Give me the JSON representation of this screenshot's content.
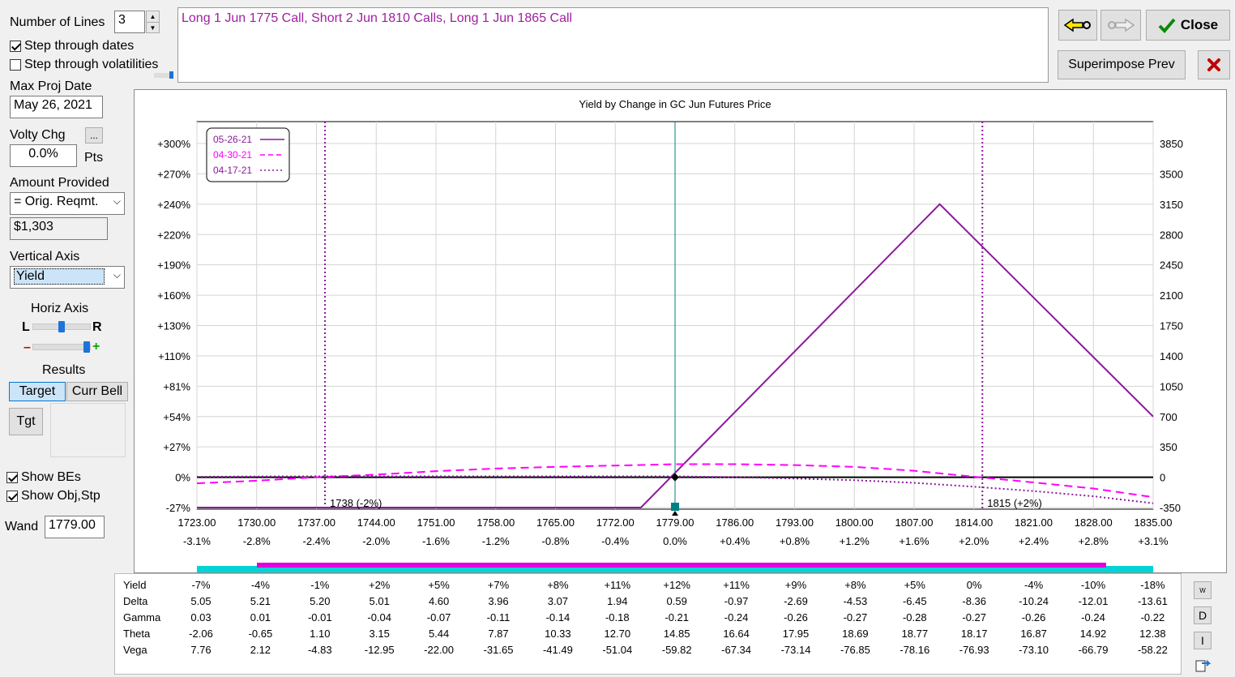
{
  "controls": {
    "number_of_lines_label": "Number of Lines",
    "number_of_lines_value": "3",
    "step_dates_label": "Step through dates",
    "step_dates_checked": true,
    "step_vols_label": "Step through volatilities",
    "step_vols_checked": false,
    "max_proj_date_label": "Max Proj Date",
    "max_proj_date_value": "May 26, 2021",
    "volty_chg_label": "Volty Chg",
    "volty_chg_button": "...",
    "volty_chg_value": "0.0%",
    "volty_chg_unit": "Pts",
    "amount_provided_label": "Amount Provided",
    "amount_provided_select": "= Orig. Reqmt.",
    "amount_value": "$1,303",
    "vertical_axis_label": "Vertical Axis",
    "vertical_axis_select": "Yield",
    "horiz_axis_label": "Horiz Axis",
    "horiz_l": "L",
    "horiz_r": "R",
    "zoom_minus": "–",
    "zoom_plus": "+",
    "results_label": "Results",
    "target_tab": "Target",
    "curr_bell_tab": "Curr Bell",
    "tgt_button": "Tgt",
    "show_bes_label": "Show BEs",
    "show_bes_checked": true,
    "show_obj_label": "Show Obj,Stp",
    "show_obj_checked": true,
    "wand_label": "Wand",
    "wand_value": "1779.00"
  },
  "strategy_text": "Long 1 Jun 1775 Call, Short 2 Jun 1810 Calls, Long 1 Jun 1865 Call",
  "toolbar": {
    "close_label": "Close",
    "superimpose_label": "Superimpose Prev"
  },
  "chart_data": {
    "type": "line",
    "title": "Yield by Change in GC Jun Futures Price",
    "x_ticks": [
      "1723.00",
      "1730.00",
      "1737.00",
      "1744.00",
      "1751.00",
      "1758.00",
      "1765.00",
      "1772.00",
      "1779.00",
      "1786.00",
      "1793.00",
      "1800.00",
      "1807.00",
      "1814.00",
      "1821.00",
      "1828.00",
      "1835.00"
    ],
    "x_pct_ticks": [
      "-3.1%",
      "-2.8%",
      "-2.4%",
      "-2.0%",
      "-1.6%",
      "-1.2%",
      "-0.8%",
      "-0.4%",
      "0.0%",
      "+0.4%",
      "+0.8%",
      "+1.2%",
      "+1.6%",
      "+2.0%",
      "+2.4%",
      "+2.8%",
      "+3.1%"
    ],
    "y_left_ticks": [
      "+300%",
      "+270%",
      "+240%",
      "+220%",
      "+190%",
      "+160%",
      "+130%",
      "+110%",
      "+81%",
      "+54%",
      "+27%",
      "0%",
      "-27%"
    ],
    "y_right_ticks": [
      "3850",
      "3500",
      "3150",
      "2800",
      "2450",
      "2100",
      "1750",
      "1400",
      "1050",
      "700",
      "350",
      "0",
      "-350"
    ],
    "xlim": [
      1723,
      1835
    ],
    "ylim_dollars": [
      -350,
      3850
    ],
    "grid": true,
    "legend_position": "top-left",
    "series": [
      {
        "name": "05-26-21",
        "color": "#8b1a9b",
        "style": "solid",
        "points": [
          [
            1723,
            -350
          ],
          [
            1775,
            -350
          ],
          [
            1810,
            3150
          ],
          [
            1835,
            700
          ]
        ]
      },
      {
        "name": "04-30-21",
        "color": "#ff00ff",
        "style": "dashed",
        "points": [
          [
            1723,
            -70
          ],
          [
            1730,
            -40
          ],
          [
            1737,
            0
          ],
          [
            1744,
            30
          ],
          [
            1751,
            70
          ],
          [
            1758,
            100
          ],
          [
            1765,
            120
          ],
          [
            1772,
            135
          ],
          [
            1779,
            150
          ],
          [
            1786,
            150
          ],
          [
            1793,
            140
          ],
          [
            1800,
            120
          ],
          [
            1807,
            75
          ],
          [
            1814,
            5
          ],
          [
            1821,
            -60
          ],
          [
            1828,
            -130
          ],
          [
            1835,
            -230
          ]
        ]
      },
      {
        "name": "04-17-21",
        "color": "#8b1a9b",
        "style": "dotted",
        "points": [
          [
            1723,
            5
          ],
          [
            1730,
            8
          ],
          [
            1737,
            10
          ],
          [
            1744,
            10
          ],
          [
            1751,
            10
          ],
          [
            1758,
            10
          ],
          [
            1765,
            10
          ],
          [
            1772,
            10
          ],
          [
            1779,
            10
          ],
          [
            1786,
            0
          ],
          [
            1793,
            -15
          ],
          [
            1800,
            -35
          ],
          [
            1807,
            -65
          ],
          [
            1814,
            -110
          ],
          [
            1821,
            -160
          ],
          [
            1828,
            -220
          ],
          [
            1835,
            -300
          ]
        ]
      }
    ],
    "markers": {
      "current_price": 1779,
      "be_lines": [
        {
          "x": 1738,
          "label": "1738 (-2%)"
        },
        {
          "x": 1815,
          "label": "1815 (+2%)"
        }
      ]
    }
  },
  "table": {
    "rows": [
      {
        "label": "Yield",
        "values": [
          "-7%",
          "-4%",
          "-1%",
          "+2%",
          "+5%",
          "+7%",
          "+8%",
          "+11%",
          "+12%",
          "+11%",
          "+9%",
          "+8%",
          "+5%",
          "0%",
          "-4%",
          "-10%",
          "-18%"
        ]
      },
      {
        "label": "Delta",
        "values": [
          "5.05",
          "5.21",
          "5.20",
          "5.01",
          "4.60",
          "3.96",
          "3.07",
          "1.94",
          "0.59",
          "-0.97",
          "-2.69",
          "-4.53",
          "-6.45",
          "-8.36",
          "-10.24",
          "-12.01",
          "-13.61"
        ]
      },
      {
        "label": "Gamma",
        "values": [
          "0.03",
          "0.01",
          "-0.01",
          "-0.04",
          "-0.07",
          "-0.11",
          "-0.14",
          "-0.18",
          "-0.21",
          "-0.24",
          "-0.26",
          "-0.27",
          "-0.28",
          "-0.27",
          "-0.26",
          "-0.24",
          "-0.22"
        ]
      },
      {
        "label": "Theta",
        "values": [
          "-2.06",
          "-0.65",
          "1.10",
          "3.15",
          "5.44",
          "7.87",
          "10.33",
          "12.70",
          "14.85",
          "16.64",
          "17.95",
          "18.69",
          "18.77",
          "18.17",
          "16.87",
          "14.92",
          "12.38"
        ]
      },
      {
        "label": "Vega",
        "values": [
          "7.76",
          "2.12",
          "-4.83",
          "-12.95",
          "-22.00",
          "-31.65",
          "-41.49",
          "-51.04",
          "-59.82",
          "-67.34",
          "-73.14",
          "-76.85",
          "-78.16",
          "-76.93",
          "-73.10",
          "-66.79",
          "-58.22"
        ]
      }
    ],
    "side_buttons": [
      "W",
      "D",
      "I"
    ]
  }
}
